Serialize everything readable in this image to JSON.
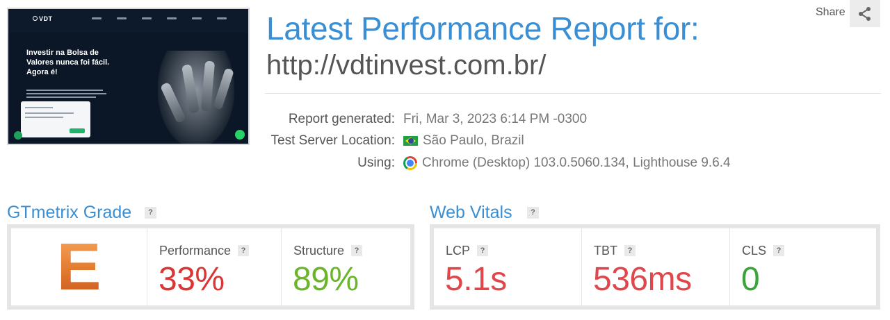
{
  "header": {
    "title": "Latest Performance Report for:",
    "url": "http://vdtinvest.com.br/",
    "share_label": "Share"
  },
  "thumbnail": {
    "logo": "VDT",
    "hero_text": "Investir na Bolsa de Valores nunca foi fácil. Agora é!"
  },
  "report_info": {
    "generated_label": "Report generated:",
    "generated_value": "Fri, Mar 3, 2023 6:14 PM -0300",
    "location_label": "Test Server Location:",
    "location_value": "São Paulo, Brazil",
    "using_label": "Using:",
    "using_value": "Chrome (Desktop) 103.0.5060.134, Lighthouse 9.6.4"
  },
  "gtmetrix": {
    "title": "GTmetrix Grade",
    "help": "?",
    "grade": "E",
    "grade_color": "#e27a2f",
    "performance_label": "Performance",
    "performance_value": "33%",
    "performance_color": "#d93636",
    "structure_label": "Structure",
    "structure_value": "89%",
    "structure_color": "#6bb52b"
  },
  "web_vitals": {
    "title": "Web Vitals",
    "help": "?",
    "lcp_label": "LCP",
    "lcp_value": "5.1s",
    "lcp_color": "#e0474c",
    "tbt_label": "TBT",
    "tbt_value": "536ms",
    "tbt_color": "#e0474c",
    "cls_label": "CLS",
    "cls_value": "0",
    "cls_color": "#3aa33a"
  },
  "icons": {
    "share": "share-icon",
    "flag": "brazil-flag-icon",
    "browser": "chrome-icon",
    "help": "question-mark-icon"
  }
}
